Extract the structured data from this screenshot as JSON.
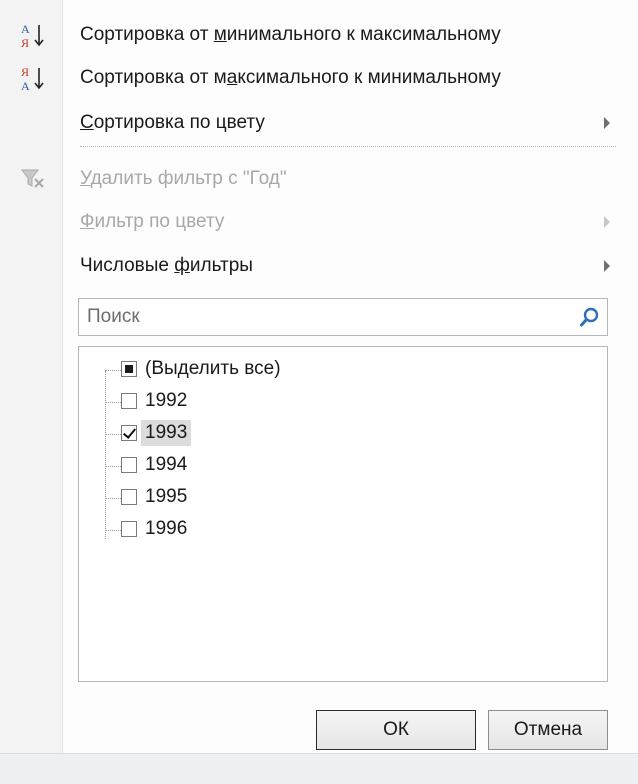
{
  "menu": {
    "sort_asc": {
      "pre": "Сортировка от ",
      "accel": "м",
      "post": "инимального к максимальному",
      "icon": "sort-ascending-icon"
    },
    "sort_desc": {
      "pre": "Сортировка от м",
      "accel": "а",
      "post": "ксимального к минимальному",
      "icon": "sort-descending-icon"
    },
    "sort_color": {
      "pre": "",
      "accel": "С",
      "post": "ортировка по цвету",
      "has_submenu": true
    },
    "clear_filter": {
      "pre": "",
      "accel": "У",
      "post": "далить фильтр с \"Год\"",
      "disabled": true,
      "icon": "clear-filter-icon"
    },
    "filter_color": {
      "pre": "",
      "accel": "Ф",
      "post": "ильтр по цвету",
      "has_submenu": true,
      "disabled": true
    },
    "number_filters": {
      "pre": "Числовые ",
      "accel": "ф",
      "post": "ильтры",
      "has_submenu": true
    }
  },
  "sort_icon_letters": {
    "top": "А",
    "bottom": "Я"
  },
  "search": {
    "placeholder": "Поиск",
    "value": ""
  },
  "list": {
    "items": [
      {
        "label": "(Выделить все)",
        "state": "partial"
      },
      {
        "label": "1992",
        "state": "unchecked"
      },
      {
        "label": "1993",
        "state": "checked",
        "selected": true
      },
      {
        "label": "1994",
        "state": "unchecked"
      },
      {
        "label": "1995",
        "state": "unchecked"
      },
      {
        "label": "1996",
        "state": "unchecked"
      }
    ]
  },
  "buttons": {
    "ok": "ОК",
    "cancel": "Отмена"
  },
  "colors": {
    "sort_icon_red": "#c0392b",
    "sort_icon_blue": "#2e5c9a",
    "search_icon": "#2f6fb5"
  }
}
